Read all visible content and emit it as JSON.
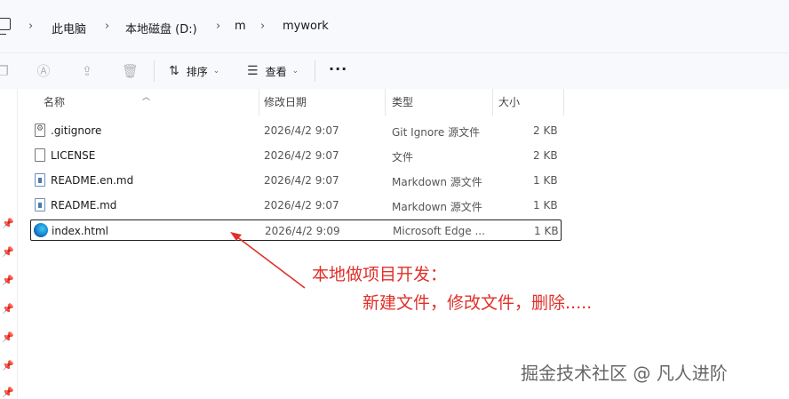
{
  "breadcrumb": [
    "此电脑",
    "本地磁盘 (D:)",
    "m",
    "mywork"
  ],
  "toolbar": {
    "sort_label": "排序",
    "view_label": "查看",
    "more_label": "···"
  },
  "columns": {
    "name": "名称",
    "date": "修改日期",
    "type": "类型",
    "size": "大小"
  },
  "files": [
    {
      "name": ".gitignore",
      "date": "2026/4/2 9:07",
      "type": "Git Ignore 源文件",
      "size": "2 KB",
      "icon": "gitignore-file-icon"
    },
    {
      "name": "LICENSE",
      "date": "2026/4/2 9:07",
      "type": "文件",
      "size": "2 KB",
      "icon": "file-icon"
    },
    {
      "name": "README.en.md",
      "date": "2026/4/2 9:07",
      "type": "Markdown 源文件",
      "size": "1 KB",
      "icon": "markdown-file-icon"
    },
    {
      "name": "README.md",
      "date": "2026/4/2 9:07",
      "type": "Markdown 源文件",
      "size": "1 KB",
      "icon": "markdown-file-icon"
    },
    {
      "name": "index.html",
      "date": "2026/4/2 9:09",
      "type": "Microsoft Edge ...",
      "size": "1 KB",
      "icon": "edge-icon"
    }
  ],
  "annotation": {
    "line1": "本地做项目开发：",
    "line2": "新建文件，修改文件，删除....."
  },
  "watermark": "掘金技术社区 @ 凡人进阶",
  "colors": {
    "annotation": "#e0302a",
    "selection_border": "#1f1f1f"
  }
}
